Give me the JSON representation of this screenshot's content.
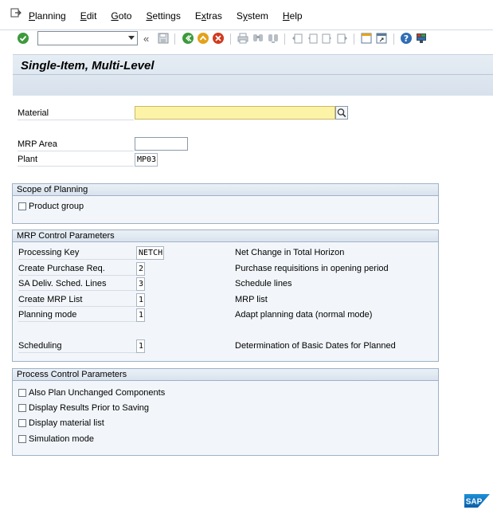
{
  "menu": {
    "items": [
      {
        "label": "Planning",
        "key": "P",
        "rest": "lanning"
      },
      {
        "label": "Edit",
        "key": "E",
        "rest": "dit"
      },
      {
        "label": "Goto",
        "key": "G",
        "rest": "oto"
      },
      {
        "label": "Settings",
        "key": "S",
        "rest": "ettings"
      },
      {
        "label": "Extras",
        "key": "x",
        "pre": "E",
        "rest": "tras"
      },
      {
        "label": "System",
        "key": "y",
        "pre": "S",
        "rest": "stem"
      },
      {
        "label": "Help",
        "key": "H",
        "rest": "elp"
      }
    ]
  },
  "toolbar": {
    "command_value": "",
    "double_arrow": "«"
  },
  "title": "Single-Item, Multi-Level",
  "fields": {
    "material_label": "Material",
    "material_value": "",
    "mrp_area_label": "MRP Area",
    "mrp_area_value": "",
    "plant_label": "Plant",
    "plant_value": "MP03"
  },
  "scope": {
    "header": "Scope of Planning",
    "product_group_label": "Product group"
  },
  "mrp_control": {
    "header": "MRP Control Parameters",
    "rows": [
      {
        "label": "Processing Key",
        "value": "NETCH",
        "desc": "Net Change in Total Horizon"
      },
      {
        "label": "Create Purchase Req.",
        "value": "2",
        "desc": "Purchase requisitions in opening period"
      },
      {
        "label": "SA Deliv. Sched. Lines",
        "value": "3",
        "desc": "Schedule lines"
      },
      {
        "label": "Create MRP List",
        "value": "1",
        "desc": "MRP list"
      },
      {
        "label": "Planning mode",
        "value": "1",
        "desc": "Adapt planning data (normal mode)"
      },
      {
        "label": "Scheduling",
        "value": "1",
        "desc": "Determination of Basic Dates for Planned"
      }
    ]
  },
  "process_control": {
    "header": "Process Control Parameters",
    "checkboxes": [
      {
        "label": "Also Plan Unchanged Components"
      },
      {
        "label": "Display Results Prior to Saving"
      },
      {
        "label": "Display material list"
      },
      {
        "label": "Simulation mode"
      }
    ]
  },
  "footer": {
    "logo_text": "SAP"
  },
  "colors": {
    "required_field": "#fdf3a6",
    "group_background": "#f2f6fa",
    "title_background": "#d7e1ec"
  }
}
